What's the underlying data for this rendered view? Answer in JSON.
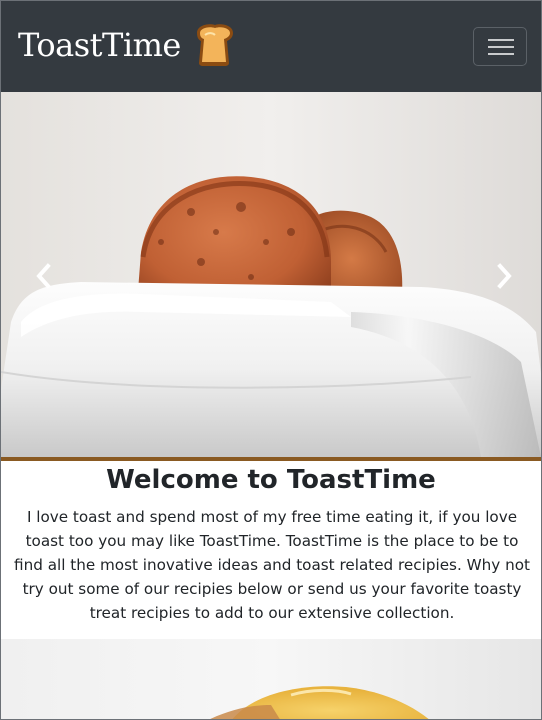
{
  "navbar": {
    "brand": "ToastTime",
    "logo_icon": "toast-icon",
    "toggler_icon": "hamburger-icon",
    "bg_color": "#343a40"
  },
  "carousel": {
    "prev_icon": "chevron-left-icon",
    "next_icon": "chevron-right-icon",
    "accent_color": "#8a5a22"
  },
  "welcome": {
    "title": "Welcome to ToastTime",
    "paragraph": "I love toast and spend most of my free time eating it, if you love toast too you may like ToastTime. ToastTime is the place to be to find all the most inovative ideas and toast related recipies. Why not try out some of our recipies below or send us your favorite toasty treat recipies to add to our extensive collection."
  }
}
